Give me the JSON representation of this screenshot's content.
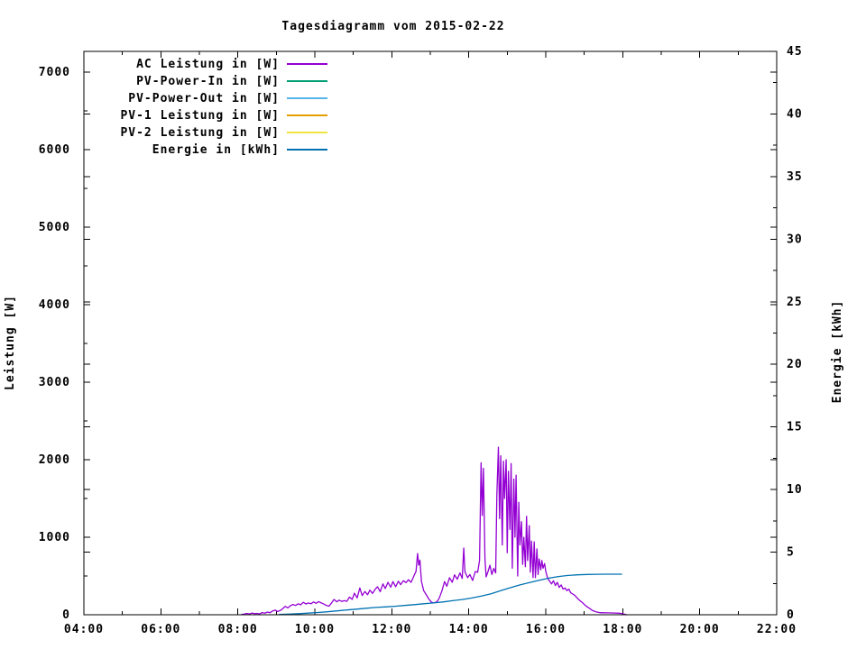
{
  "title": "Tagesdiagramm vom 2015-02-22",
  "chart_data": {
    "type": "line",
    "title": "Tagesdiagramm vom 2015-02-22",
    "ylabel": "Leistung [W]",
    "y2label": "Energie [kWh]",
    "grid": false,
    "legend_position": "top-left-inside",
    "x_axis": {
      "min": 4,
      "max": 22,
      "major_step": 2,
      "minor_step": 1,
      "tick_values": [
        4,
        6,
        8,
        10,
        12,
        14,
        16,
        18,
        20,
        22
      ],
      "tick_labels": [
        "04:00",
        "06:00",
        "08:00",
        "10:00",
        "12:00",
        "14:00",
        "16:00",
        "18:00",
        "20:00",
        "22:00"
      ]
    },
    "y_axis": {
      "min": 0,
      "max": 7267,
      "major_step": 1000,
      "minor_step": 500,
      "tick_values": [
        0,
        1000,
        2000,
        3000,
        4000,
        5000,
        6000,
        7000
      ],
      "tick_labels": [
        "0",
        "1000",
        "2000",
        "3000",
        "4000",
        "5000",
        "6000",
        "7000"
      ]
    },
    "y2_axis": {
      "min": 0,
      "max": 45,
      "major_step": 5,
      "minor_step": 2.5,
      "tick_values": [
        0,
        5,
        10,
        15,
        20,
        25,
        30,
        35,
        40,
        45
      ],
      "tick_labels": [
        "0",
        "5",
        "10",
        "15",
        "20",
        "25",
        "30",
        "35",
        "40",
        "45"
      ]
    },
    "series": [
      {
        "name": "AC Leistung in [W]",
        "color": "#9400d3",
        "axis": "y1",
        "points": [
          [
            8.1,
            3
          ],
          [
            8.17,
            8
          ],
          [
            8.23,
            18
          ],
          [
            8.3,
            10
          ],
          [
            8.37,
            22
          ],
          [
            8.43,
            14
          ],
          [
            8.5,
            18
          ],
          [
            8.57,
            10
          ],
          [
            8.63,
            28
          ],
          [
            8.7,
            20
          ],
          [
            8.77,
            35
          ],
          [
            8.83,
            25
          ],
          [
            8.9,
            48
          ],
          [
            8.97,
            60
          ],
          [
            9.03,
            42
          ],
          [
            9.1,
            55
          ],
          [
            9.17,
            80
          ],
          [
            9.23,
            108
          ],
          [
            9.3,
            88
          ],
          [
            9.37,
            118
          ],
          [
            9.43,
            132
          ],
          [
            9.5,
            120
          ],
          [
            9.57,
            142
          ],
          [
            9.63,
            128
          ],
          [
            9.7,
            160
          ],
          [
            9.77,
            138
          ],
          [
            9.83,
            152
          ],
          [
            9.9,
            142
          ],
          [
            9.97,
            165
          ],
          [
            10.03,
            148
          ],
          [
            10.1,
            170
          ],
          [
            10.17,
            152
          ],
          [
            10.23,
            138
          ],
          [
            10.3,
            120
          ],
          [
            10.37,
            112
          ],
          [
            10.43,
            148
          ],
          [
            10.5,
            198
          ],
          [
            10.57,
            168
          ],
          [
            10.63,
            188
          ],
          [
            10.7,
            172
          ],
          [
            10.77,
            182
          ],
          [
            10.83,
            172
          ],
          [
            10.9,
            228
          ],
          [
            10.97,
            198
          ],
          [
            11.03,
            278
          ],
          [
            11.1,
            218
          ],
          [
            11.17,
            345
          ],
          [
            11.23,
            248
          ],
          [
            11.3,
            300
          ],
          [
            11.37,
            258
          ],
          [
            11.43,
            318
          ],
          [
            11.5,
            275
          ],
          [
            11.57,
            330
          ],
          [
            11.63,
            360
          ],
          [
            11.7,
            298
          ],
          [
            11.77,
            398
          ],
          [
            11.83,
            338
          ],
          [
            11.9,
            418
          ],
          [
            11.97,
            355
          ],
          [
            12.03,
            428
          ],
          [
            12.1,
            362
          ],
          [
            12.17,
            432
          ],
          [
            12.23,
            388
          ],
          [
            12.3,
            440
          ],
          [
            12.37,
            415
          ],
          [
            12.43,
            452
          ],
          [
            12.5,
            418
          ],
          [
            12.57,
            498
          ],
          [
            12.63,
            560
          ],
          [
            12.67,
            790
          ],
          [
            12.7,
            640
          ],
          [
            12.73,
            705
          ],
          [
            12.77,
            430
          ],
          [
            12.83,
            310
          ],
          [
            12.9,
            255
          ],
          [
            12.97,
            198
          ],
          [
            13.03,
            162
          ],
          [
            13.1,
            152
          ],
          [
            13.17,
            168
          ],
          [
            13.23,
            212
          ],
          [
            13.3,
            305
          ],
          [
            13.37,
            428
          ],
          [
            13.43,
            368
          ],
          [
            13.5,
            478
          ],
          [
            13.57,
            418
          ],
          [
            13.63,
            515
          ],
          [
            13.7,
            458
          ],
          [
            13.77,
            540
          ],
          [
            13.83,
            468
          ],
          [
            13.87,
            860
          ],
          [
            13.9,
            555
          ],
          [
            13.97,
            478
          ],
          [
            14.03,
            518
          ],
          [
            14.1,
            442
          ],
          [
            14.17,
            558
          ],
          [
            14.23,
            548
          ],
          [
            14.28,
            700
          ],
          [
            14.32,
            1960
          ],
          [
            14.35,
            1280
          ],
          [
            14.38,
            1890
          ],
          [
            14.42,
            720
          ],
          [
            14.45,
            488
          ],
          [
            14.5,
            558
          ],
          [
            14.55,
            638
          ],
          [
            14.6,
            518
          ],
          [
            14.65,
            598
          ],
          [
            14.7,
            540
          ],
          [
            14.73,
            1550
          ],
          [
            14.77,
            2160
          ],
          [
            14.8,
            1240
          ],
          [
            14.83,
            2050
          ],
          [
            14.87,
            900
          ],
          [
            14.9,
            1980
          ],
          [
            14.93,
            1500
          ],
          [
            14.97,
            2000
          ],
          [
            15.0,
            800
          ],
          [
            15.03,
            1850
          ],
          [
            15.07,
            1100
          ],
          [
            15.1,
            1950
          ],
          [
            15.13,
            600
          ],
          [
            15.17,
            1750
          ],
          [
            15.2,
            1000
          ],
          [
            15.23,
            1800
          ],
          [
            15.27,
            500
          ],
          [
            15.3,
            1450
          ],
          [
            15.33,
            900
          ],
          [
            15.37,
            1200
          ],
          [
            15.4,
            650
          ],
          [
            15.43,
            1000
          ],
          [
            15.47,
            620
          ],
          [
            15.5,
            1270
          ],
          [
            15.53,
            700
          ],
          [
            15.57,
            1150
          ],
          [
            15.6,
            550
          ],
          [
            15.63,
            950
          ],
          [
            15.67,
            480
          ],
          [
            15.7,
            940
          ],
          [
            15.73,
            478
          ],
          [
            15.77,
            850
          ],
          [
            15.8,
            520
          ],
          [
            15.83,
            720
          ],
          [
            15.87,
            580
          ],
          [
            15.9,
            700
          ],
          [
            15.93,
            600
          ],
          [
            15.97,
            660
          ],
          [
            16.0,
            560
          ],
          [
            16.05,
            470
          ],
          [
            16.1,
            432
          ],
          [
            16.15,
            398
          ],
          [
            16.2,
            438
          ],
          [
            16.25,
            378
          ],
          [
            16.3,
            418
          ],
          [
            16.35,
            352
          ],
          [
            16.4,
            385
          ],
          [
            16.45,
            330
          ],
          [
            16.5,
            345
          ],
          [
            16.55,
            312
          ],
          [
            16.6,
            330
          ],
          [
            16.65,
            282
          ],
          [
            16.7,
            268
          ],
          [
            16.75,
            252
          ],
          [
            16.8,
            225
          ],
          [
            16.85,
            198
          ],
          [
            16.9,
            178
          ],
          [
            16.95,
            158
          ],
          [
            17.0,
            132
          ],
          [
            17.05,
            112
          ],
          [
            17.1,
            95
          ],
          [
            17.15,
            78
          ],
          [
            17.2,
            58
          ],
          [
            17.25,
            48
          ],
          [
            17.3,
            38
          ],
          [
            17.37,
            30
          ],
          [
            17.43,
            26
          ],
          [
            17.5,
            25
          ],
          [
            17.6,
            24
          ],
          [
            17.7,
            23
          ],
          [
            17.8,
            22
          ],
          [
            17.9,
            20
          ],
          [
            17.97,
            16
          ],
          [
            18.03,
            8
          ],
          [
            18.1,
            0
          ]
        ]
      },
      {
        "name": "PV-Power-In in [W]",
        "color": "#009e73",
        "axis": "y1",
        "points": []
      },
      {
        "name": "PV-Power-Out in [W]",
        "color": "#56b4e9",
        "axis": "y1",
        "points": []
      },
      {
        "name": "PV-1 Leistung in [W]",
        "color": "#e69f00",
        "axis": "y1",
        "points": []
      },
      {
        "name": "PV-2 Leistung in [W]",
        "color": "#f0e442",
        "axis": "y1",
        "points": []
      },
      {
        "name": "Energie in [kWh]",
        "color": "#0072b2",
        "axis": "y2",
        "points": [
          [
            9.08,
            0.02
          ],
          [
            9.33,
            0.05
          ],
          [
            9.58,
            0.09
          ],
          [
            9.83,
            0.13
          ],
          [
            10.08,
            0.18
          ],
          [
            10.33,
            0.24
          ],
          [
            10.58,
            0.31
          ],
          [
            10.83,
            0.38
          ],
          [
            11.08,
            0.45
          ],
          [
            11.33,
            0.52
          ],
          [
            11.58,
            0.58
          ],
          [
            11.83,
            0.63
          ],
          [
            12.08,
            0.68
          ],
          [
            12.33,
            0.74
          ],
          [
            12.58,
            0.81
          ],
          [
            12.83,
            0.88
          ],
          [
            13.08,
            0.94
          ],
          [
            13.33,
            1.02
          ],
          [
            13.58,
            1.12
          ],
          [
            13.83,
            1.22
          ],
          [
            14.08,
            1.34
          ],
          [
            14.33,
            1.5
          ],
          [
            14.58,
            1.68
          ],
          [
            14.83,
            1.92
          ],
          [
            15.08,
            2.16
          ],
          [
            15.33,
            2.38
          ],
          [
            15.58,
            2.58
          ],
          [
            15.83,
            2.76
          ],
          [
            16.08,
            2.92
          ],
          [
            16.33,
            3.05
          ],
          [
            16.58,
            3.14
          ],
          [
            16.83,
            3.19
          ],
          [
            17.08,
            3.22
          ],
          [
            17.33,
            3.23
          ],
          [
            17.58,
            3.24
          ],
          [
            17.83,
            3.24
          ],
          [
            17.97,
            3.24
          ]
        ]
      }
    ]
  }
}
